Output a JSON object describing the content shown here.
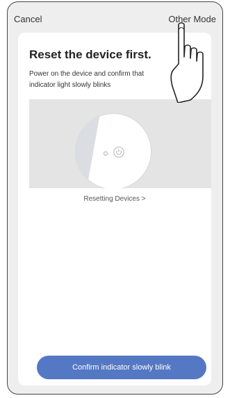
{
  "topbar": {
    "cancel_label": "Cancel",
    "other_mode_label": "Other Mode"
  },
  "card": {
    "title": "Reset the device first.",
    "description": "Power on the device and confirm that indicator light slowly blinks",
    "reset_link": "Resetting Devices >",
    "confirm_button": "Confirm indicator slowly blink"
  },
  "icons": {
    "power": "power-icon",
    "indicator": "indicator-light-icon",
    "hand": "pointing-hand-icon"
  },
  "colors": {
    "accent": "#5578c4",
    "screen_background": "#eeeeee",
    "card_background": "#ffffff"
  }
}
